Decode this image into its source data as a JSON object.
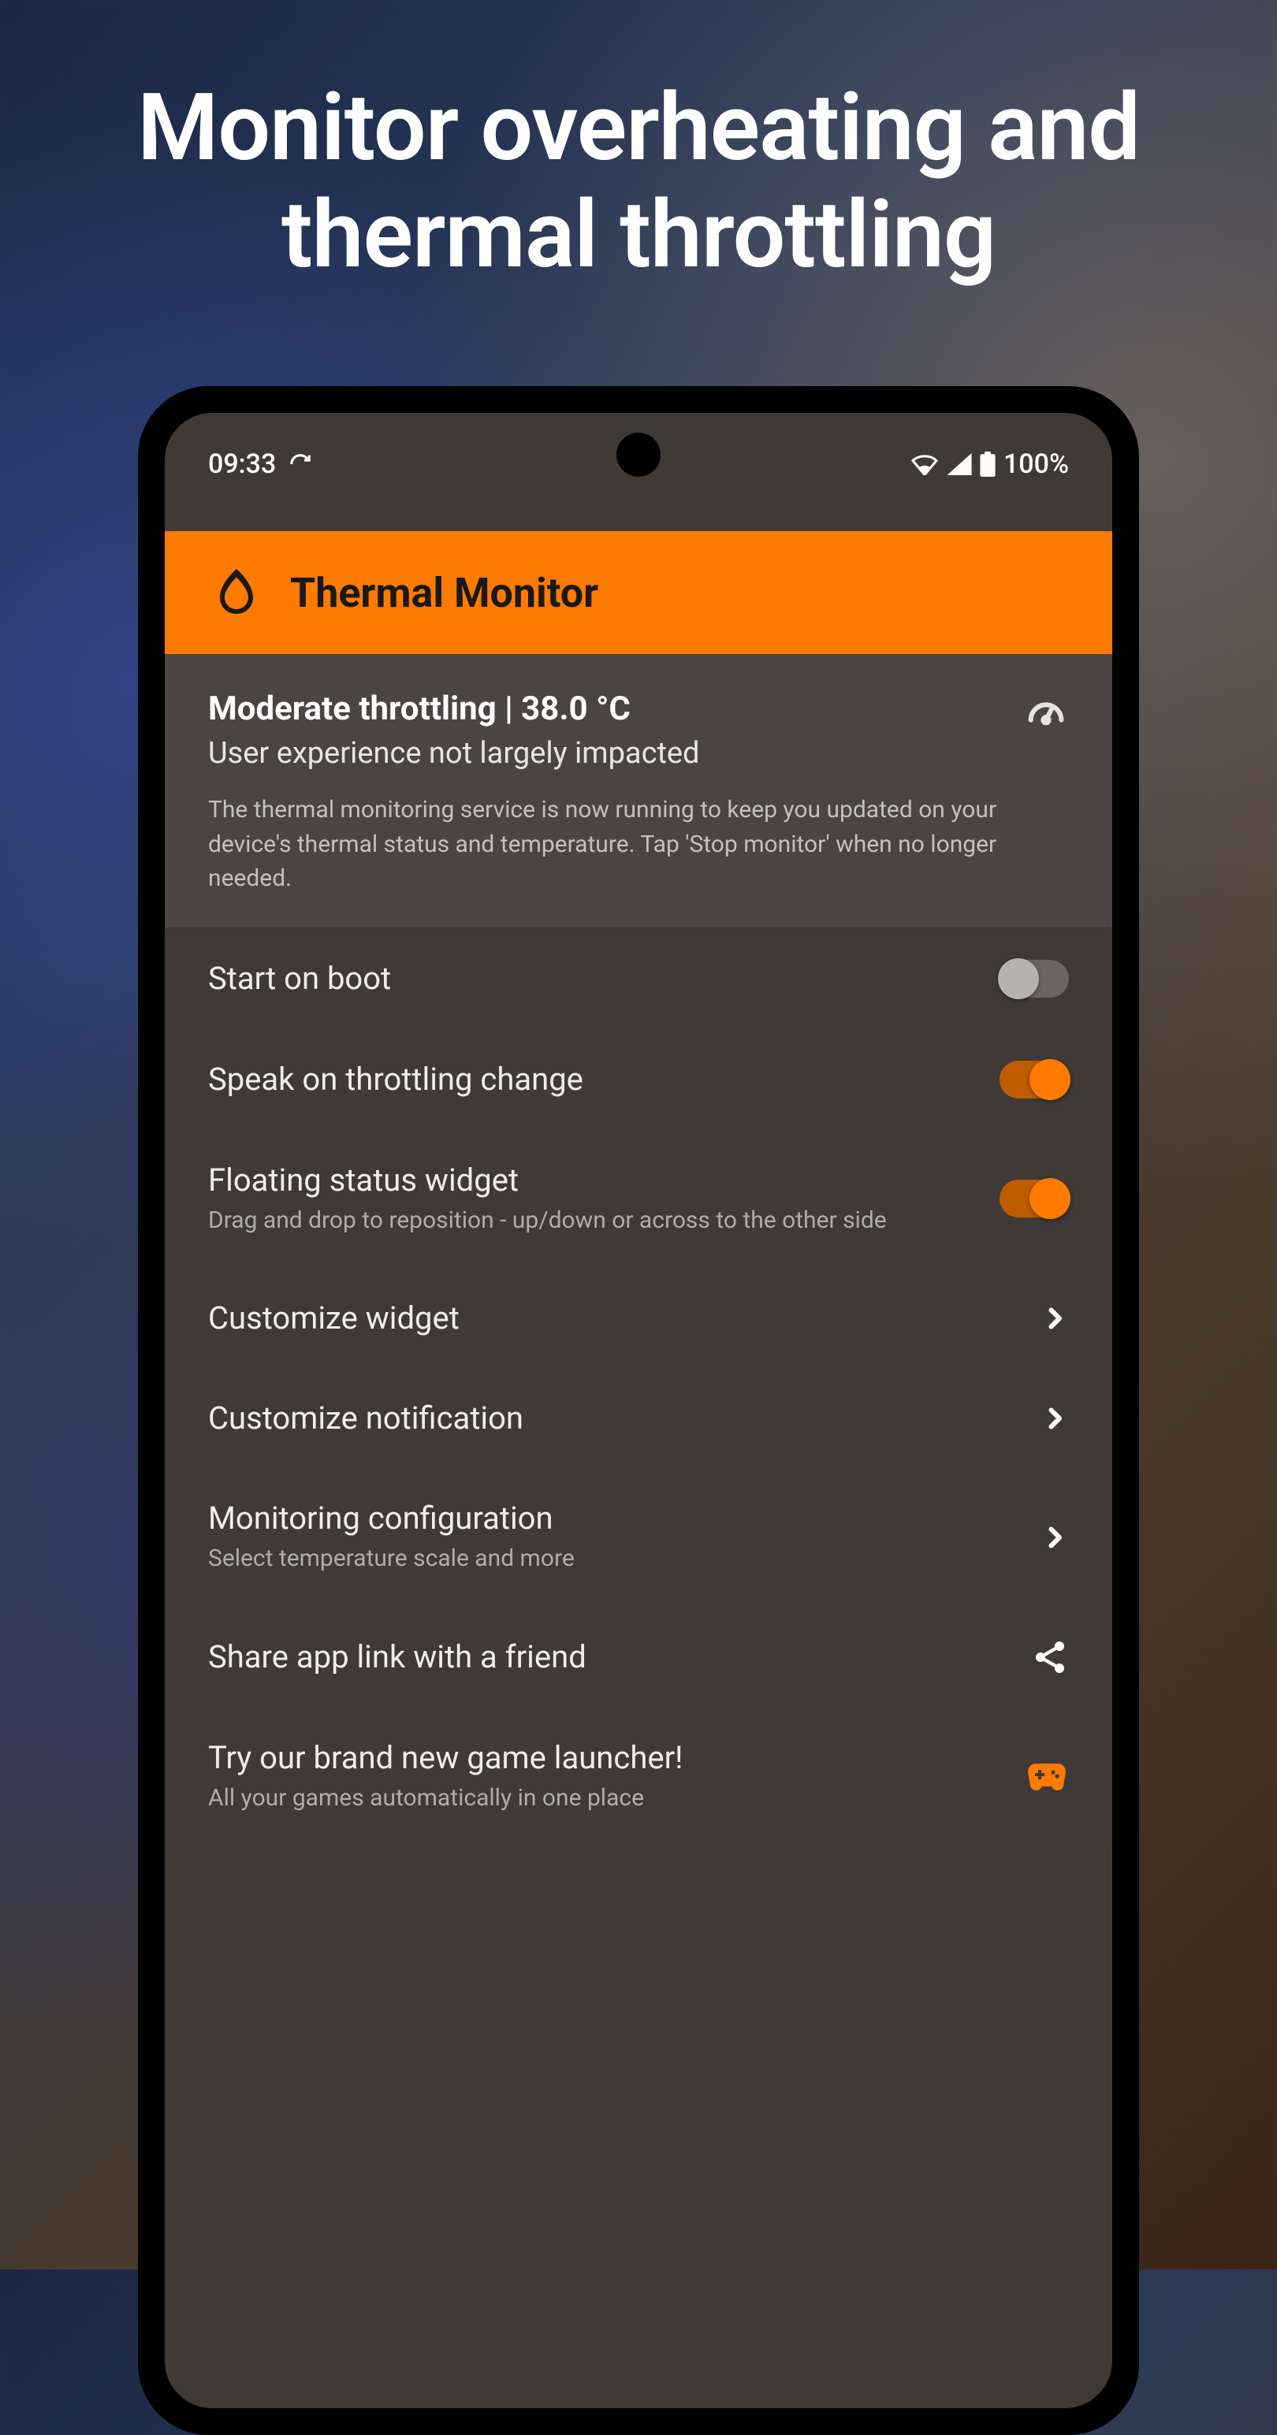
{
  "headline": "Monitor overheating and thermal throttling",
  "statusbar": {
    "time": "09:33",
    "battery_pct": "100%"
  },
  "app": {
    "title": "Thermal Monitor"
  },
  "status": {
    "title": "Moderate throttling | 38.0 °C",
    "subtitle": "User experience not largely impacted",
    "description": "The thermal monitoring service is now running to keep you updated on your device's thermal status and temperature. Tap 'Stop monitor' when no longer needed."
  },
  "settings": {
    "start_on_boot": {
      "label": "Start on boot",
      "enabled": false
    },
    "speak_change": {
      "label": "Speak on throttling change",
      "enabled": true
    },
    "floating_widget": {
      "label": "Floating status widget",
      "sub": "Drag and drop to reposition - up/down or across to the other side",
      "enabled": true
    },
    "customize_widget": {
      "label": "Customize widget"
    },
    "customize_notification": {
      "label": "Customize notification"
    },
    "monitoring_config": {
      "label": "Monitoring configuration",
      "sub": "Select temperature scale and more"
    },
    "share": {
      "label": "Share app link with a friend"
    },
    "game_launcher": {
      "label": "Try our brand new game launcher!",
      "sub": "All your games automatically in one place"
    }
  }
}
